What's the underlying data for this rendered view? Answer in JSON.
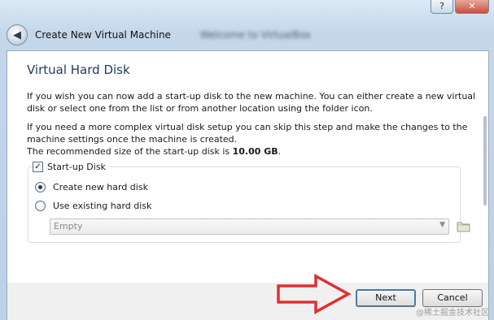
{
  "window": {
    "minimize_glyph": "?",
    "close_glyph": "✕"
  },
  "header": {
    "back_glyph": "◀",
    "title": "Create New Virtual Machine",
    "blurred_text": "Welcome to VirtualBox"
  },
  "page": {
    "heading": "Virtual Hard Disk",
    "paragraph1": "If you wish you can now add a start-up disk to the new machine. You can either create a new virtual disk or select one from the list or from another location using the folder icon.",
    "paragraph2": "If you need a more complex virtual disk setup you can skip this step and make the changes to the machine settings once the machine is created.",
    "recommended_prefix": "The recommended size of the start-up disk is ",
    "recommended_size": "10.00 GB",
    "recommended_suffix": "."
  },
  "startup_disk": {
    "label": "Start-up Disk",
    "checked_glyph": "✓",
    "option_create": "Create new hard disk",
    "option_existing": "Use existing hard disk",
    "selected": "create",
    "existing_value": "Empty",
    "dropdown_glyph": "▼"
  },
  "footer": {
    "next_label": "Next",
    "cancel_label": "Cancel"
  },
  "annotation_arrow_color": "#e03030",
  "watermark": "@稀土掘金技术社区",
  "icons": {
    "back": "back-arrow-icon",
    "folder": "folder-icon",
    "close": "close-icon",
    "help": "help-icon"
  }
}
